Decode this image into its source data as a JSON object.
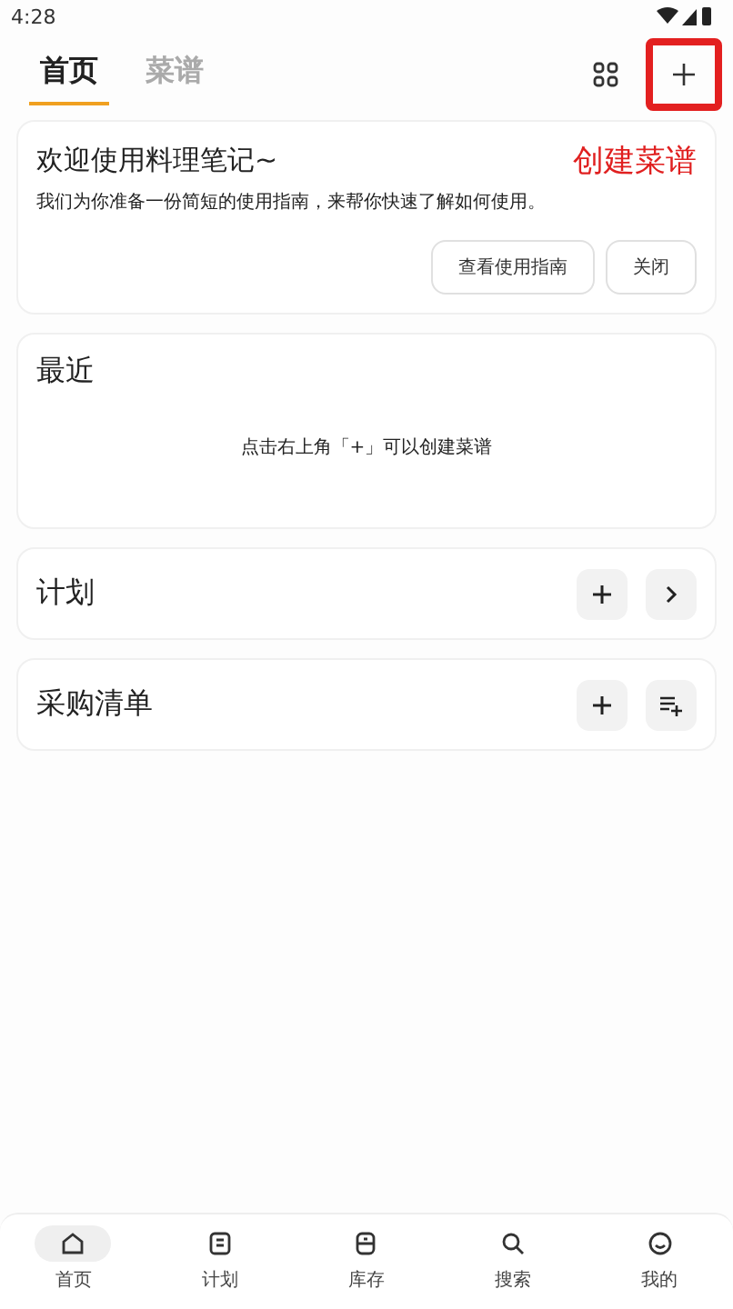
{
  "status_bar": {
    "time": "4:28"
  },
  "tabs": [
    {
      "label": "首页",
      "selected": true
    },
    {
      "label": "菜谱",
      "selected": false
    }
  ],
  "add_button": {
    "highlighted": true
  },
  "annotation": {
    "text": "创建菜谱"
  },
  "welcome": {
    "title": "欢迎使用料理笔记~",
    "text": "我们为你准备一份简短的使用指南，来帮你快速了解如何使用。",
    "buttons": [
      "查看使用指南",
      "关闭"
    ]
  },
  "recent": {
    "title": "最近",
    "empty_text": "点击右上角「+」可以创建菜谱"
  },
  "sections": [
    {
      "title": "计划",
      "kind": "plan"
    },
    {
      "title": "采购清单",
      "kind": "shopping"
    }
  ],
  "bottom_nav": [
    {
      "label": "首页",
      "selected": true
    },
    {
      "label": "计划",
      "selected": false
    },
    {
      "label": "库存",
      "selected": false
    },
    {
      "label": "搜索",
      "selected": false
    },
    {
      "label": "我的",
      "selected": false
    }
  ]
}
